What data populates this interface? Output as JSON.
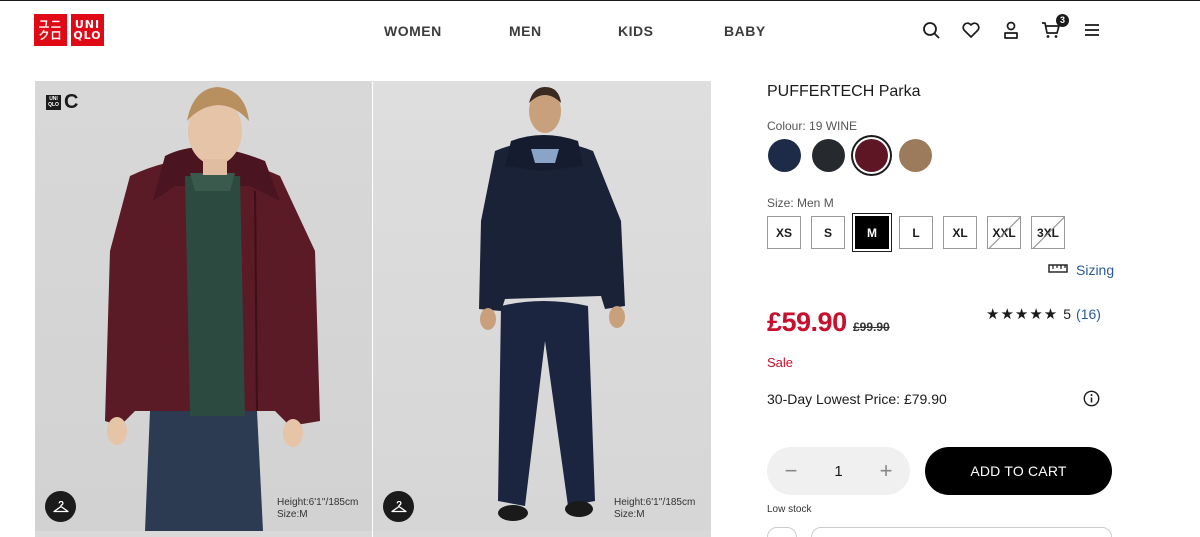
{
  "header": {
    "logo_top": "ユニクロ",
    "logo_bottom": "UNIQLO",
    "logo_top_left": "ユニ",
    "logo_bottom_left": "クロ",
    "logo_top_right": "UNI",
    "logo_bottom_right": "QLO",
    "nav": [
      "WOMEN",
      "MEN",
      "KIDS",
      "BABY"
    ],
    "cart_count": "3",
    "icons": [
      "search-icon",
      "heart-icon",
      "user-icon",
      "cart-icon",
      "menu-icon"
    ]
  },
  "gallery": {
    "brand_mark_letter": "C",
    "photos": [
      {
        "model_height": "Height:6'1''/185cm",
        "model_size": "Size:M",
        "garment_color": "#5a1a26"
      },
      {
        "model_height": "Height:6'1''/185cm",
        "model_size": "Size:M",
        "garment_color": "#1c2540"
      }
    ]
  },
  "product": {
    "title": "PUFFERTECH Parka",
    "colour_label": "Colour: 19 WINE",
    "colours": [
      {
        "name": "navy",
        "hex": "#1d2a48",
        "selected": false
      },
      {
        "name": "black",
        "hex": "#262a2e",
        "selected": false
      },
      {
        "name": "wine",
        "hex": "#5e1624",
        "selected": true
      },
      {
        "name": "brown",
        "hex": "#9c7a5c",
        "selected": false
      }
    ],
    "size_label": "Size: Men M",
    "sizes": [
      {
        "label": "XS",
        "state": "available"
      },
      {
        "label": "S",
        "state": "available"
      },
      {
        "label": "M",
        "state": "selected"
      },
      {
        "label": "L",
        "state": "available"
      },
      {
        "label": "XL",
        "state": "available"
      },
      {
        "label": "XXL",
        "state": "out-of-stock"
      },
      {
        "label": "3XL",
        "state": "out-of-stock"
      }
    ],
    "sizing_link": "Sizing",
    "price": "£59.90",
    "original_price": "£99.90",
    "rating_stars": "★★★★★",
    "rating_value": "5",
    "rating_count": "(16)",
    "sale_label": "Sale",
    "lowest_price": "30-Day Lowest Price: £79.90",
    "quantity": "1",
    "quantity_minus": "−",
    "quantity_plus": "+",
    "add_to_cart": "ADD TO CART",
    "stock_status": "Low stock",
    "accent_color": "#c8102e"
  }
}
